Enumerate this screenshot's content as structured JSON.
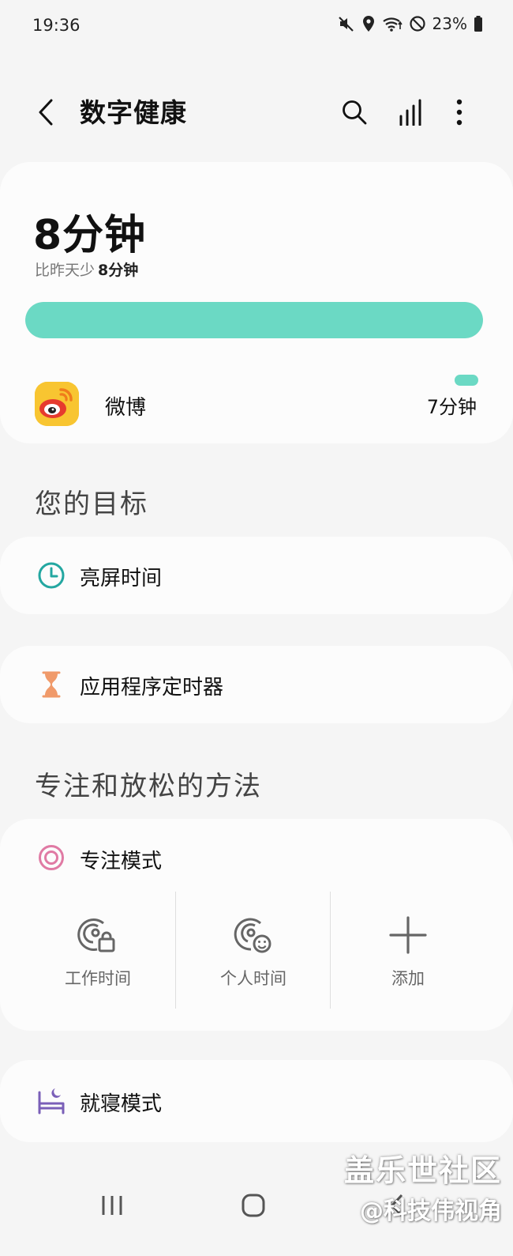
{
  "status_bar": {
    "time": "19:36",
    "battery_percent": "23%"
  },
  "app_bar": {
    "title": "数字健康",
    "icons": [
      "back-icon",
      "search-icon",
      "bar-chart-icon",
      "more-vert-icon"
    ]
  },
  "usage": {
    "total": "8分钟",
    "compare_text": "比昨天少",
    "compare_value": "8分钟",
    "bar_fill_fraction": 1.0,
    "bar_color": "#6bd9c4",
    "apps": [
      {
        "name": "微博",
        "time": "7分钟",
        "icon": "weibo-icon"
      }
    ]
  },
  "goals": {
    "title": "您的目标",
    "items": [
      {
        "label": "亮屏时间",
        "icon": "clock-icon",
        "color": "#23a7a1"
      },
      {
        "label": "应用程序定时器",
        "icon": "hourglass-icon",
        "color": "#f09a6a"
      }
    ]
  },
  "focus_relax": {
    "title": "专注和放松的方法",
    "focus_mode": {
      "label": "专注模式",
      "icon": "target-icon",
      "color": "#e07aa4",
      "options": [
        {
          "label": "工作时间",
          "icon": "work-focus-icon"
        },
        {
          "label": "个人时间",
          "icon": "personal-focus-icon"
        },
        {
          "label": "添加",
          "icon": "plus-icon"
        }
      ]
    },
    "bedtime_mode": {
      "label": "就寝模式",
      "icon": "bed-moon-icon",
      "color": "#7a5fb8"
    }
  },
  "nav_bar": {
    "icons": [
      "recents-icon",
      "home-icon",
      "back-nav-icon"
    ]
  },
  "watermark": {
    "line1": "盖乐世社区",
    "line2": "@科技伟视角"
  }
}
